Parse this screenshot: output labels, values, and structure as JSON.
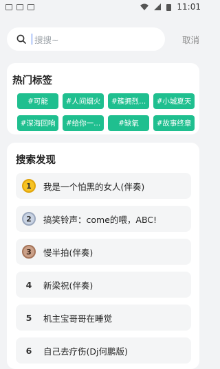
{
  "status": {
    "time": "11:01"
  },
  "search": {
    "placeholder": "搜搜~",
    "cancel": "取消"
  },
  "hot": {
    "title": "热门标签",
    "tags": [
      "#可能",
      "#人间烟火",
      "#簇拥烈...",
      "#小城夏天",
      "#深海回响",
      "#给你一...",
      "#缺氧",
      "#故事终章"
    ]
  },
  "discover": {
    "title": "搜索发现",
    "items": [
      {
        "rank": "1",
        "title": "我是一个怕黑的女人(伴奏)"
      },
      {
        "rank": "2",
        "title": "搞笑铃声：come的喂，ABC!"
      },
      {
        "rank": "3",
        "title": "慢半拍(伴奏)"
      },
      {
        "rank": "4",
        "title": "新梁祝(伴奏)"
      },
      {
        "rank": "5",
        "title": "机主宝哥哥在睡觉"
      },
      {
        "rank": "6",
        "title": "自己去疗伤(Dj何鹏版)"
      }
    ]
  },
  "colors": {
    "tag": "#1fbf8f",
    "page": "#f2f3f5"
  }
}
